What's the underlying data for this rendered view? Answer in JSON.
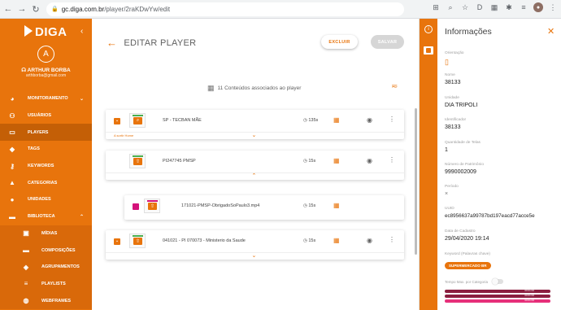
{
  "browser": {
    "url_host": "gc.diga.com.br",
    "url_path": "/player/2raKDwYw/edit"
  },
  "sidebar": {
    "logo": "DIGA",
    "avatar_initial": "A",
    "user_name": "ARTHUR BORBA",
    "user_email": "arthborba@gmail.com",
    "items": [
      {
        "label": "MONITORAMENTO",
        "icon": "monitor-icon"
      },
      {
        "label": "USUÁRIOS",
        "icon": "users-icon"
      },
      {
        "label": "PLAYERS",
        "icon": "tv-icon"
      },
      {
        "label": "TAGS",
        "icon": "tag-icon"
      },
      {
        "label": "KEYWORDS",
        "icon": "key-icon"
      },
      {
        "label": "CATEGORIAS",
        "icon": "category-icon"
      },
      {
        "label": "UNIDADES",
        "icon": "location-icon"
      },
      {
        "label": "BIBLIOTECA",
        "icon": "folder-icon"
      }
    ],
    "sub_items": [
      {
        "label": "MÍDIAS",
        "icon": "media-icon"
      },
      {
        "label": "COMPOSIÇÕES",
        "icon": "composition-icon"
      },
      {
        "label": "AGRUPAMENTOS",
        "icon": "group-icon"
      },
      {
        "label": "PLAYLISTS",
        "icon": "playlist-icon"
      },
      {
        "label": "WEBFRAMES",
        "icon": "web-icon"
      }
    ]
  },
  "main": {
    "title": "EDITAR PLAYER",
    "delete_label": "EXCLUIR",
    "save_label": "SALVAR",
    "content_count": "11 Conteúdos associados ao player",
    "cards": [
      {
        "name": "SP - TECBAN MÃE",
        "duration": "135s",
        "footer_tag": "A sortir Home"
      },
      {
        "name": "PI247745 PMSP",
        "duration": "15s"
      },
      {
        "name": "171021-PMSP-ObrigadoSoPaulo3.mp4",
        "duration": "15s"
      },
      {
        "name": "041021 - PI 070073 - Ministerio da Saude",
        "duration": "15s"
      }
    ]
  },
  "panel": {
    "title": "Informações",
    "fields": {
      "orientacao_label": "Orientação",
      "nome_label": "Nome",
      "nome": "38133",
      "unidade_label": "Unidade",
      "unidade": "DIA TRIPOLI",
      "identificador_label": "Identificador",
      "identificador": "38133",
      "telas_label": "Quantidade de Telas",
      "telas": "1",
      "patrimonio_label": "Número de Patrimônio",
      "patrimonio": "9990002009",
      "periodo_label": "Período",
      "periodo": "×",
      "uuid_label": "UUID",
      "uuid": "ec8956637a99787bd197eacd77acce5e",
      "cadastro_label": "Data de Cadastro",
      "cadastro": "29/04/2020 19:14",
      "keyword_label": "Keyword (Palavras chave)",
      "keyword": "SUPERMERCADO BR",
      "tempo_label": "Tempo Max. por Categoria"
    },
    "bars": [
      {
        "color": "#8b1e3f",
        "label": "00:01:00"
      },
      {
        "color": "#8b1e3f",
        "label": "00:01:00"
      },
      {
        "color": "#e6307a",
        "label": "00:01:00"
      }
    ]
  }
}
